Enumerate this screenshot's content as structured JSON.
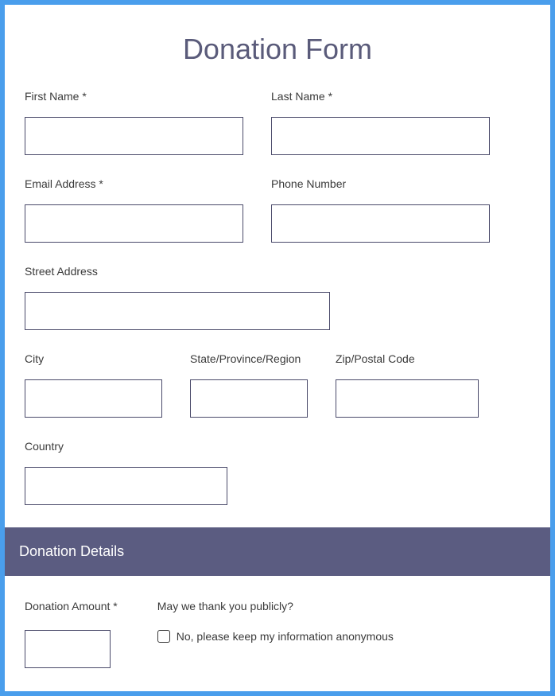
{
  "title": "Donation Form",
  "fields": {
    "first_name": {
      "label": "First Name *"
    },
    "last_name": {
      "label": "Last Name *"
    },
    "email": {
      "label": "Email Address *"
    },
    "phone": {
      "label": "Phone Number"
    },
    "street": {
      "label": "Street Address"
    },
    "city": {
      "label": "City"
    },
    "state": {
      "label": "State/Province/Region"
    },
    "zip": {
      "label": "Zip/Postal Code"
    },
    "country": {
      "label": "Country"
    }
  },
  "section": {
    "donation_details": "Donation Details"
  },
  "donation": {
    "amount_label": "Donation Amount *",
    "thank_question": "May we thank you publicly?",
    "anonymous_label": "No, please keep my information anonymous"
  }
}
